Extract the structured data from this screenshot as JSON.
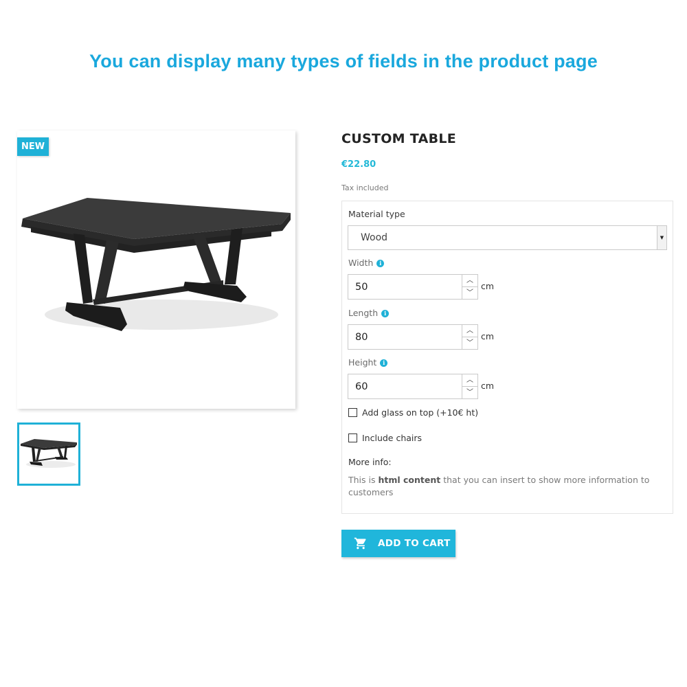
{
  "headline": "You can display many types of fields in the product page",
  "product": {
    "badge": "NEW",
    "title": "CUSTOM TABLE",
    "price": "€22.80",
    "tax_note": "Tax included"
  },
  "fields": {
    "material": {
      "label": "Material type",
      "selected": "Wood"
    },
    "width": {
      "label": "Width",
      "value": "50",
      "unit": "cm"
    },
    "length": {
      "label": "Length",
      "value": "80",
      "unit": "cm"
    },
    "height": {
      "label": "Height",
      "value": "60",
      "unit": "cm"
    },
    "glass": {
      "label": "Add glass on top (+10€ ht)"
    },
    "chairs": {
      "label": "Include chairs"
    },
    "more_info": {
      "label": "More info:",
      "text_before": "This is ",
      "text_bold": "html content",
      "text_after": " that you can insert to show more information to customers"
    }
  },
  "cart_button": {
    "label": "ADD TO CART",
    "icon": "shopping-cart-icon"
  },
  "colors": {
    "accent": "#1fb1d7",
    "headline": "#1aa8dd"
  }
}
